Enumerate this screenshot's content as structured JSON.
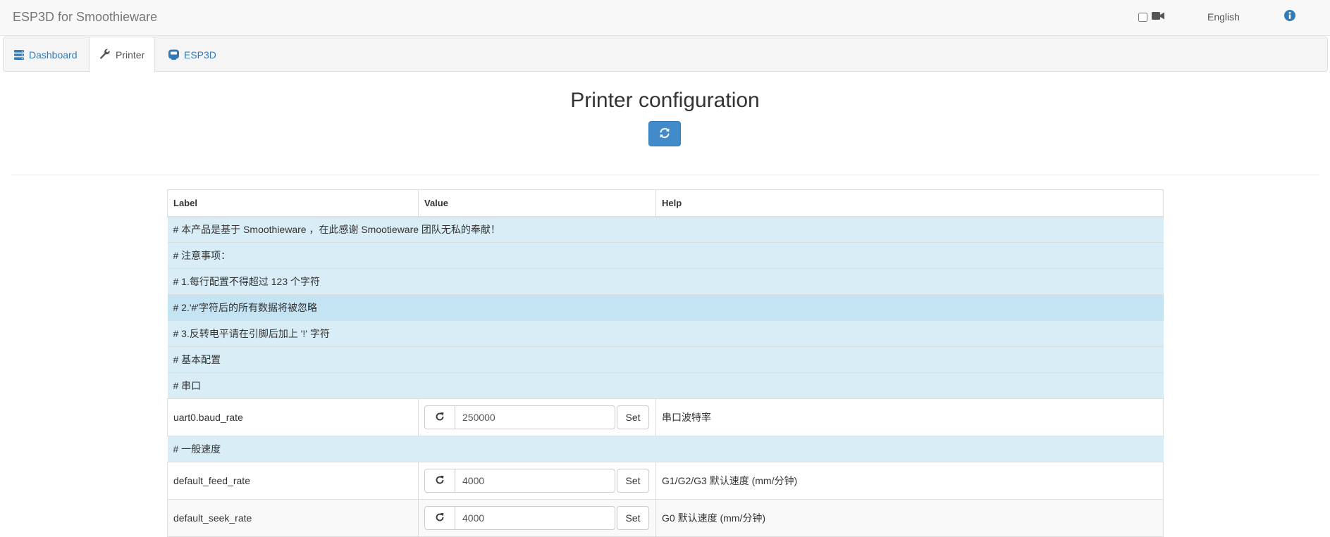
{
  "app": {
    "title": "ESP3D for Smoothieware"
  },
  "navbar": {
    "language": "English"
  },
  "tabs": [
    {
      "label": "Dashboard",
      "icon": "dashboard-icon"
    },
    {
      "label": "Printer",
      "icon": "wrench-icon",
      "active": true
    },
    {
      "label": "ESP3D",
      "icon": "esp3d-icon"
    }
  ],
  "page": {
    "title": "Printer configuration"
  },
  "table": {
    "headers": {
      "label": "Label",
      "value": "Value",
      "help": "Help"
    },
    "rows": [
      {
        "type": "comment",
        "text": "# 本产品是基于 Smoothieware ，在此感谢 Smootieware 团队无私的奉献！"
      },
      {
        "type": "comment",
        "text": "# 注意事项："
      },
      {
        "type": "comment",
        "text": "# 1.每行配置不得超过 123 个字符"
      },
      {
        "type": "comment",
        "text": "# 2.'#'字符后的所有数据将被忽略"
      },
      {
        "type": "comment",
        "text": "# 3.反转电平请在引脚后加上 '!' 字符"
      },
      {
        "type": "comment",
        "text": "# 基本配置"
      },
      {
        "type": "comment",
        "text": "# 串口"
      },
      {
        "type": "setting",
        "label": "uart0.baud_rate",
        "value": "250000",
        "set_label": "Set",
        "help": "串口波特率"
      },
      {
        "type": "comment",
        "text": "# 一般速度"
      },
      {
        "type": "setting",
        "label": "default_feed_rate",
        "value": "4000",
        "set_label": "Set",
        "help": "G1/G2/G3 默认速度 (mm/分钟)"
      },
      {
        "type": "setting",
        "label": "default_seek_rate",
        "value": "4000",
        "set_label": "Set",
        "help": "G0 默认速度 (mm/分钟)"
      }
    ]
  },
  "colors": {
    "accent": "#337ab7",
    "primary_button": "#428bca",
    "comment_row": "#d9edf7",
    "comment_row_hover": "#c4e3f3"
  }
}
